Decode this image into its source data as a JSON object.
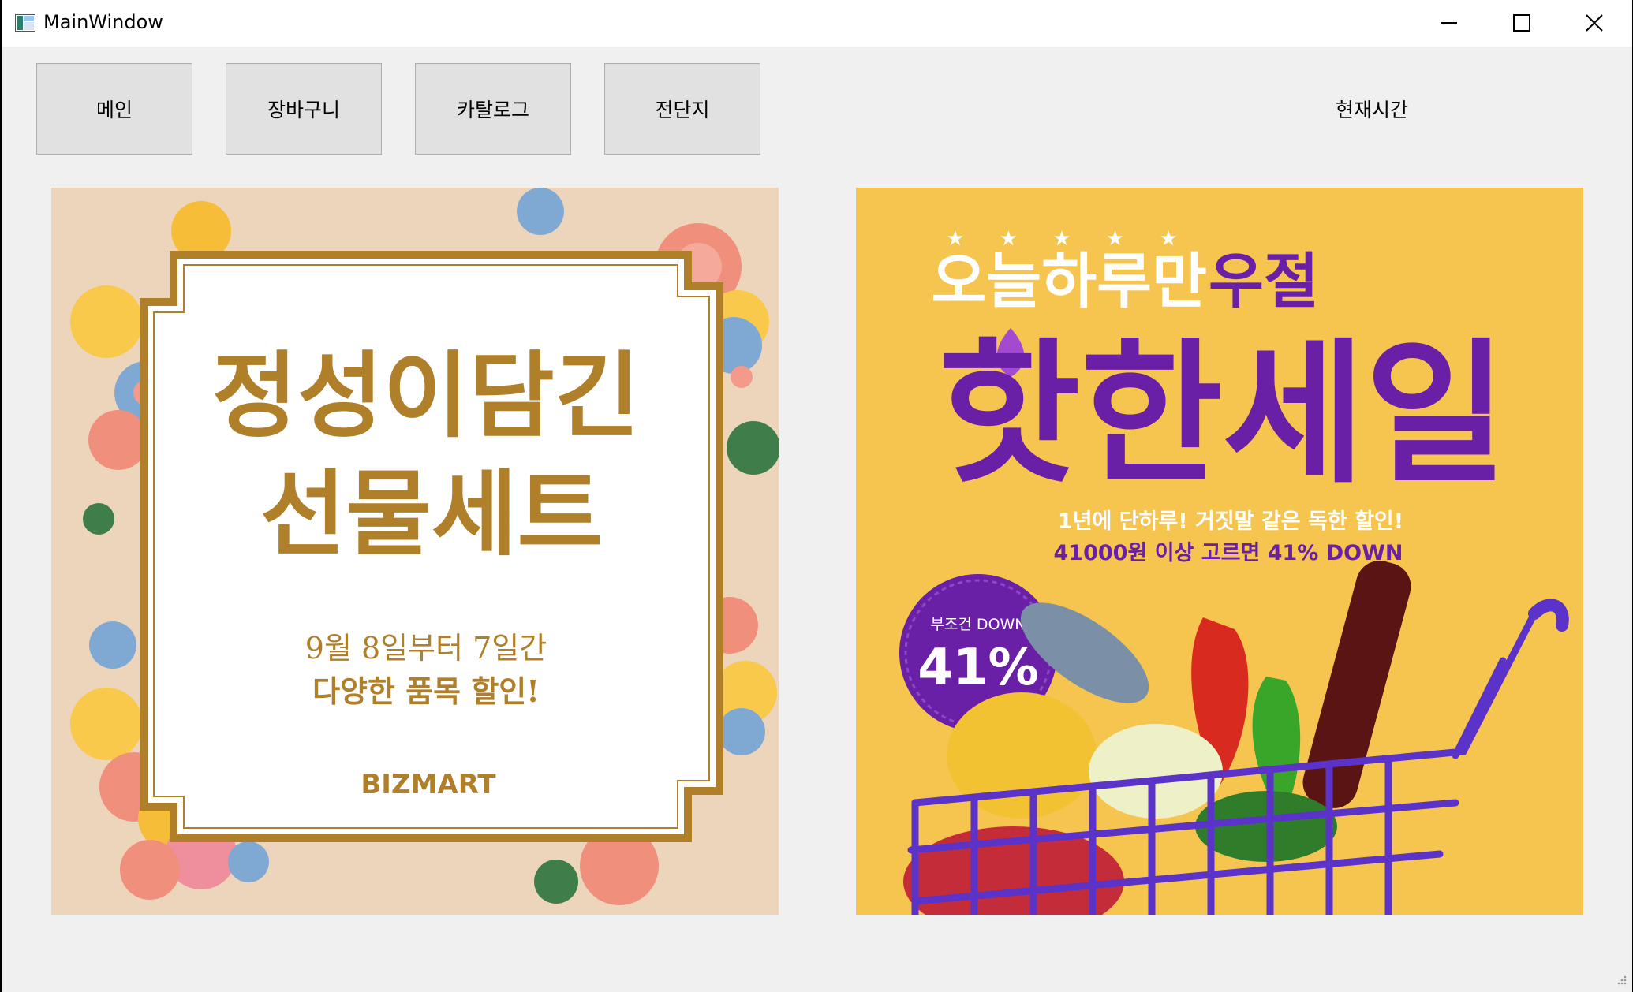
{
  "window": {
    "title": "MainWindow"
  },
  "toolbar": {
    "main_label": "메인",
    "cart_label": "장바구니",
    "catalog_label": "카탈로그",
    "flyer_label": "전단지"
  },
  "clock": {
    "label": "현재시간"
  },
  "banners": {
    "gift": {
      "headline_1": "정성이담긴",
      "headline_2": "선물세트",
      "date_line": "9월 8일부터 7일간",
      "discount_line": "다양한 품목 할인!",
      "brand": "BIZMART"
    },
    "sale": {
      "stars": "★ ★ ★ ★ ★",
      "subtitle_a": "오늘하루만",
      "subtitle_b": "우절",
      "headline": "핫한세일",
      "copy_1": "1년에 단하루! 거짓말 같은 독한 할인!",
      "copy_2": "41000원 이상 고르면 41% DOWN",
      "badge_small": "부조건 DOWN",
      "badge_big": "41%"
    }
  },
  "colors": {
    "gift_bg": "#edd5bb",
    "gift_gold": "#b07f2a",
    "sale_bg": "#f5c54f",
    "sale_purple": "#6a20a6",
    "button_bg": "#e1e1e1",
    "window_bg": "#f0f0f0"
  }
}
